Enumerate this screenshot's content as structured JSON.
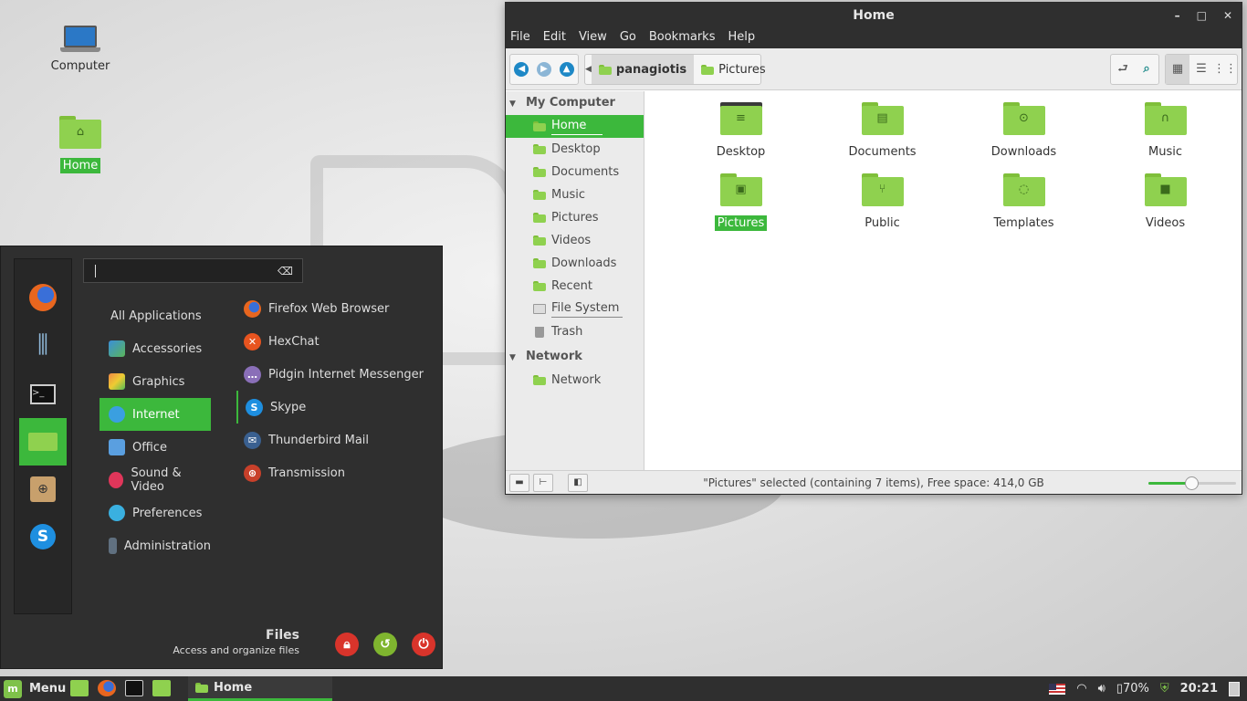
{
  "desktop": {
    "icons": [
      {
        "label": "Computer"
      },
      {
        "label": "Home"
      }
    ]
  },
  "file_manager": {
    "title": "Home",
    "window_controls": {
      "minimize": "–",
      "maximize": "□",
      "close": "✕"
    },
    "menu": [
      "File",
      "Edit",
      "View",
      "Go",
      "Bookmarks",
      "Help"
    ],
    "breadcrumbs": [
      "panagiotis",
      "Pictures"
    ],
    "sidebar": {
      "section_my_computer": "My Computer",
      "places": [
        "Home",
        "Desktop",
        "Documents",
        "Music",
        "Pictures",
        "Videos",
        "Downloads",
        "Recent",
        "File System",
        "Trash"
      ],
      "section_network": "Network",
      "network_items": [
        "Network"
      ]
    },
    "folders": [
      {
        "label": "Desktop",
        "icon": "desktop-icon"
      },
      {
        "label": "Documents",
        "icon": "document-icon"
      },
      {
        "label": "Downloads",
        "icon": "download-icon"
      },
      {
        "label": "Music",
        "icon": "headphones-icon"
      },
      {
        "label": "Pictures",
        "icon": "image-icon"
      },
      {
        "label": "Public",
        "icon": "share-icon"
      },
      {
        "label": "Templates",
        "icon": "template-icon"
      },
      {
        "label": "Videos",
        "icon": "video-icon"
      }
    ],
    "status_text": "\"Pictures\" selected (containing 7 items), Free space: 414,0 GB",
    "zoom_level": 0.5
  },
  "start_menu": {
    "search_placeholder": "",
    "categories": [
      "All Applications",
      "Accessories",
      "Graphics",
      "Internet",
      "Office",
      "Sound & Video",
      "Preferences",
      "Administration"
    ],
    "selected_category": "Internet",
    "apps": [
      "Firefox Web Browser",
      "HexChat",
      "Pidgin Internet Messenger",
      "Skype",
      "Thunderbird Mail",
      "Transmission"
    ],
    "description_title": "Files",
    "description_sub": "Access and organize files"
  },
  "panel": {
    "menu_label": "Menu",
    "task_label": "Home",
    "battery": "70%",
    "clock": "20:21"
  },
  "colors": {
    "accent": "#3cb83c",
    "folder": "#8fd14f",
    "dark": "#2f2f2f"
  }
}
